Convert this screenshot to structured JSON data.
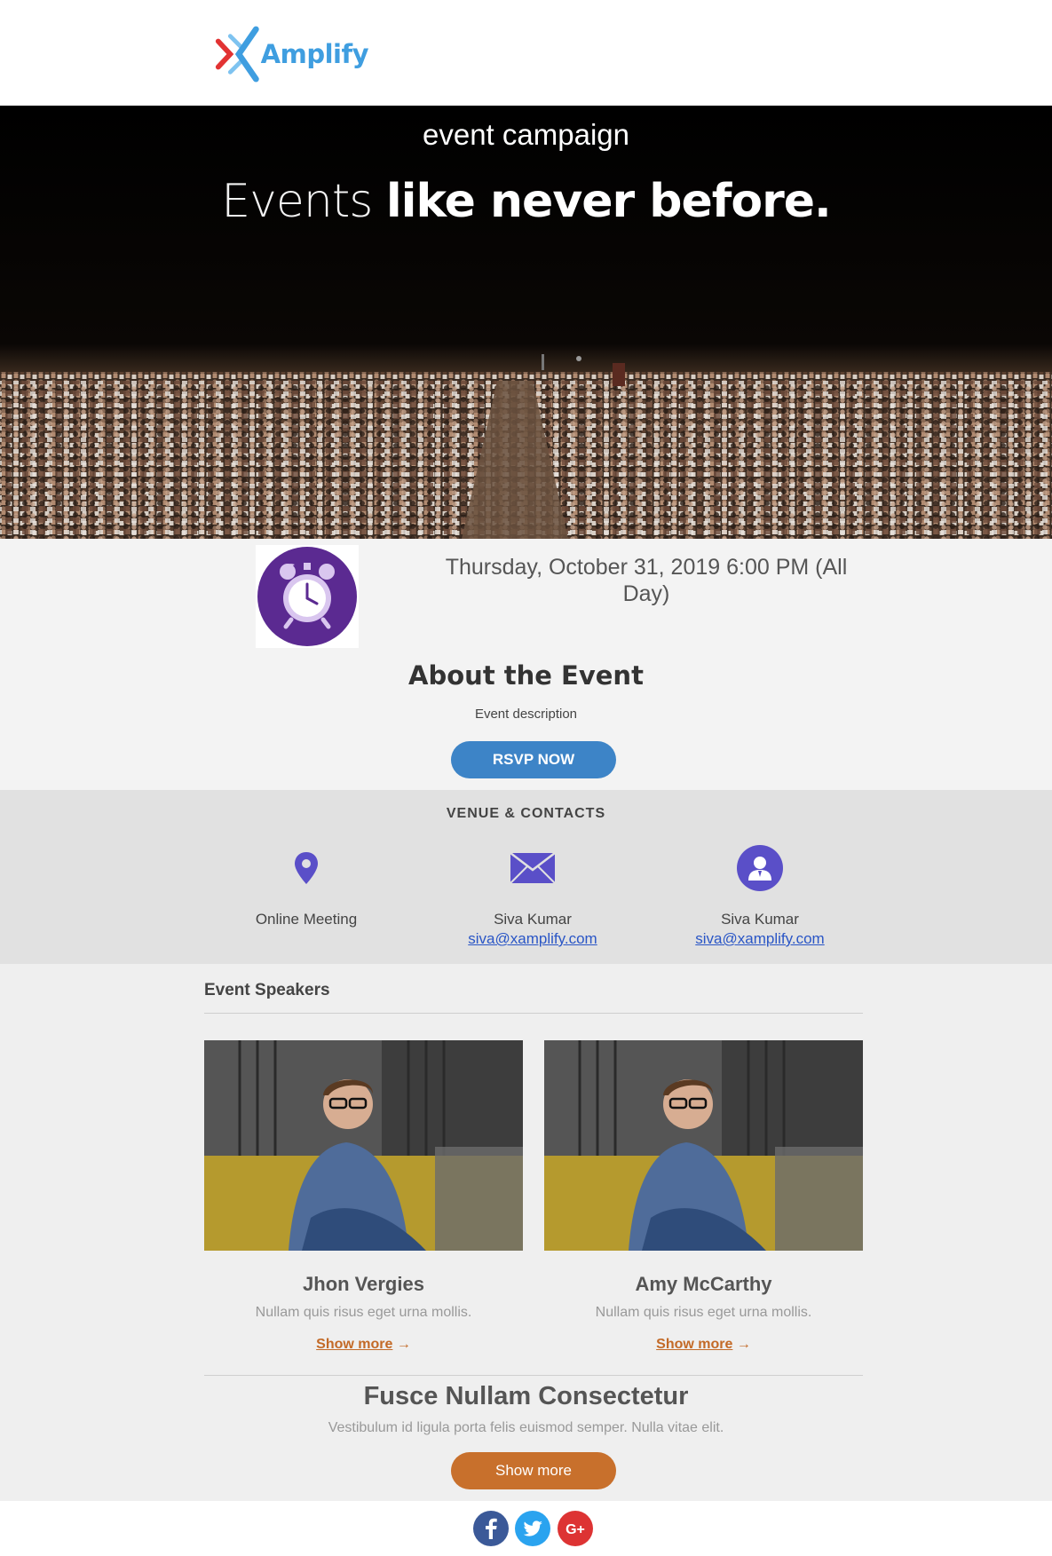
{
  "brand": {
    "name": "Amplify",
    "colors": {
      "blue": "#3f9ee0",
      "red": "#e23333",
      "purple": "#5b2a91",
      "accent_orange": "#c8702c",
      "rsvp_blue": "#3d84c7"
    }
  },
  "hero": {
    "kicker": "event campaign",
    "title_light": "Events ",
    "title_bold": "like never before."
  },
  "event": {
    "icon": "alarm-clock-icon",
    "date_line1": "Thursday, October 31, 2019 6:00 PM (All",
    "date_line2": "Day)",
    "about_title": "About the Event",
    "about_description": "Event description",
    "rsvp_label": "RSVP NOW"
  },
  "venue": {
    "title": "VENUE & CONTACTS",
    "items": [
      {
        "icon": "map-pin-icon",
        "name": "Online Meeting",
        "email": ""
      },
      {
        "icon": "envelope-icon",
        "name": "Siva Kumar",
        "email": "siva@xamplify.com"
      },
      {
        "icon": "contact-person-icon",
        "name": "Siva Kumar",
        "email": "siva@xamplify.com"
      }
    ]
  },
  "speakers": {
    "title": "Event Speakers",
    "items": [
      {
        "name": "Jhon Vergies",
        "description": "Nullam quis risus eget urna mollis.",
        "more": "Show more",
        "arrow": "→"
      },
      {
        "name": "Amy McCarthy",
        "description": "Nullam quis risus eget urna mollis.",
        "more": "Show more",
        "arrow": "→"
      }
    ]
  },
  "feature": {
    "title": "Fusce Nullam Consectetur",
    "description": "Vestibulum id ligula porta felis euismod semper. Nulla vitae elit.",
    "button": "Show more"
  },
  "social": [
    {
      "icon": "facebook-icon",
      "glyph": "f"
    },
    {
      "icon": "twitter-icon",
      "glyph": ""
    },
    {
      "icon": "google-plus-icon",
      "glyph": "G+"
    }
  ]
}
